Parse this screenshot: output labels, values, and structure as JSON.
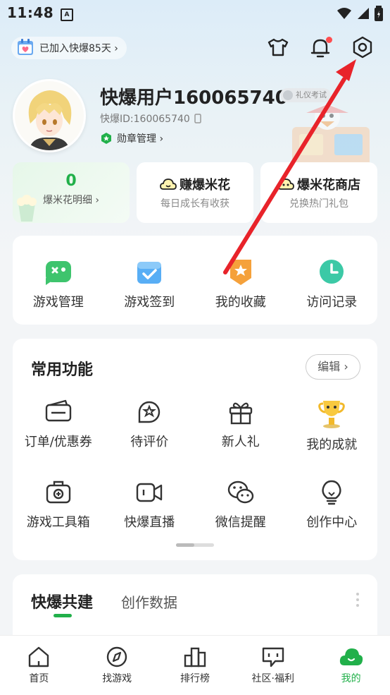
{
  "status_bar": {
    "time": "11:48",
    "a_icon": "A"
  },
  "header": {
    "days_label": "已加入快爆85天 ›",
    "icons": [
      "shirt-icon",
      "bell-icon",
      "settings-icon"
    ]
  },
  "profile": {
    "username": "快爆用户160065740",
    "badge": "礼仪考试",
    "user_id": "快爆ID:160065740",
    "medal_label": "勋章管理 ›"
  },
  "stats": [
    {
      "value": "0",
      "label": "爆米花明细 ›"
    },
    {
      "title": "赚爆米花",
      "subtitle": "每日成长有收获"
    },
    {
      "title": "爆米花商店",
      "subtitle": "兑换热门礼包"
    }
  ],
  "quick_actions": [
    {
      "label": "游戏管理",
      "icon": "gamepad-icon"
    },
    {
      "label": "游戏签到",
      "icon": "calendar-check-icon"
    },
    {
      "label": "我的收藏",
      "icon": "star-badge-icon"
    },
    {
      "label": "访问记录",
      "icon": "clock-icon"
    }
  ],
  "common_functions": {
    "title": "常用功能",
    "edit_label": "编辑 ›",
    "row1": [
      {
        "label": "订单/优惠券",
        "icon": "ticket-icon"
      },
      {
        "label": "待评价",
        "icon": "rating-icon"
      },
      {
        "label": "新人礼",
        "icon": "gift-icon"
      },
      {
        "label": "我的成就",
        "icon": "trophy-icon"
      }
    ],
    "row2": [
      {
        "label": "游戏工具箱",
        "icon": "toolbox-icon"
      },
      {
        "label": "快爆直播",
        "icon": "video-camera-icon"
      },
      {
        "label": "微信提醒",
        "icon": "wechat-icon"
      },
      {
        "label": "创作中心",
        "icon": "lightbulb-icon"
      }
    ]
  },
  "build_section": {
    "tab_active": "快爆共建",
    "tab_other": "创作数据"
  },
  "bottom_nav": [
    {
      "label": "首页",
      "icon": "home-icon"
    },
    {
      "label": "找游戏",
      "icon": "compass-icon"
    },
    {
      "label": "排行榜",
      "icon": "ranking-icon"
    },
    {
      "label": "社区·福利",
      "icon": "community-icon"
    },
    {
      "label": "我的",
      "icon": "profile-cloud-icon"
    }
  ],
  "colors": {
    "accent": "#21b04a",
    "arrow": "#e8232a",
    "notification": "#ff4d4f"
  }
}
